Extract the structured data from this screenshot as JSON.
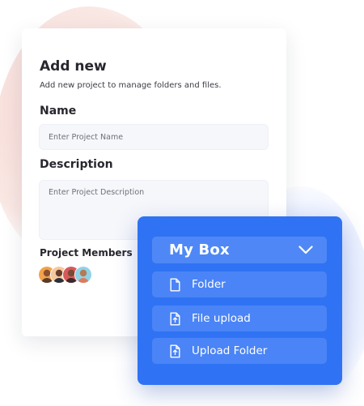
{
  "card": {
    "title": "Add new",
    "subtitle": "Add new project to manage folders and files.",
    "name_label": "Name",
    "name_placeholder": "Enter Project Name",
    "description_label": "Description",
    "description_placeholder": "Enter Project Description",
    "members_label": "Project Members"
  },
  "panel": {
    "dropdown_label": "My Box",
    "dropdown_icon": "chevron-down-icon",
    "items": [
      {
        "label": "Folder",
        "icon": "file-icon"
      },
      {
        "label": "File upload",
        "icon": "file-upload-icon"
      },
      {
        "label": "Upload Folder",
        "icon": "upload-folder-icon"
      }
    ]
  },
  "colors": {
    "panel_bg": "#2f73f4",
    "panel_item_bg": "#4a84f6",
    "title_text": "#27272e",
    "input_bg": "#f6f7fb"
  }
}
